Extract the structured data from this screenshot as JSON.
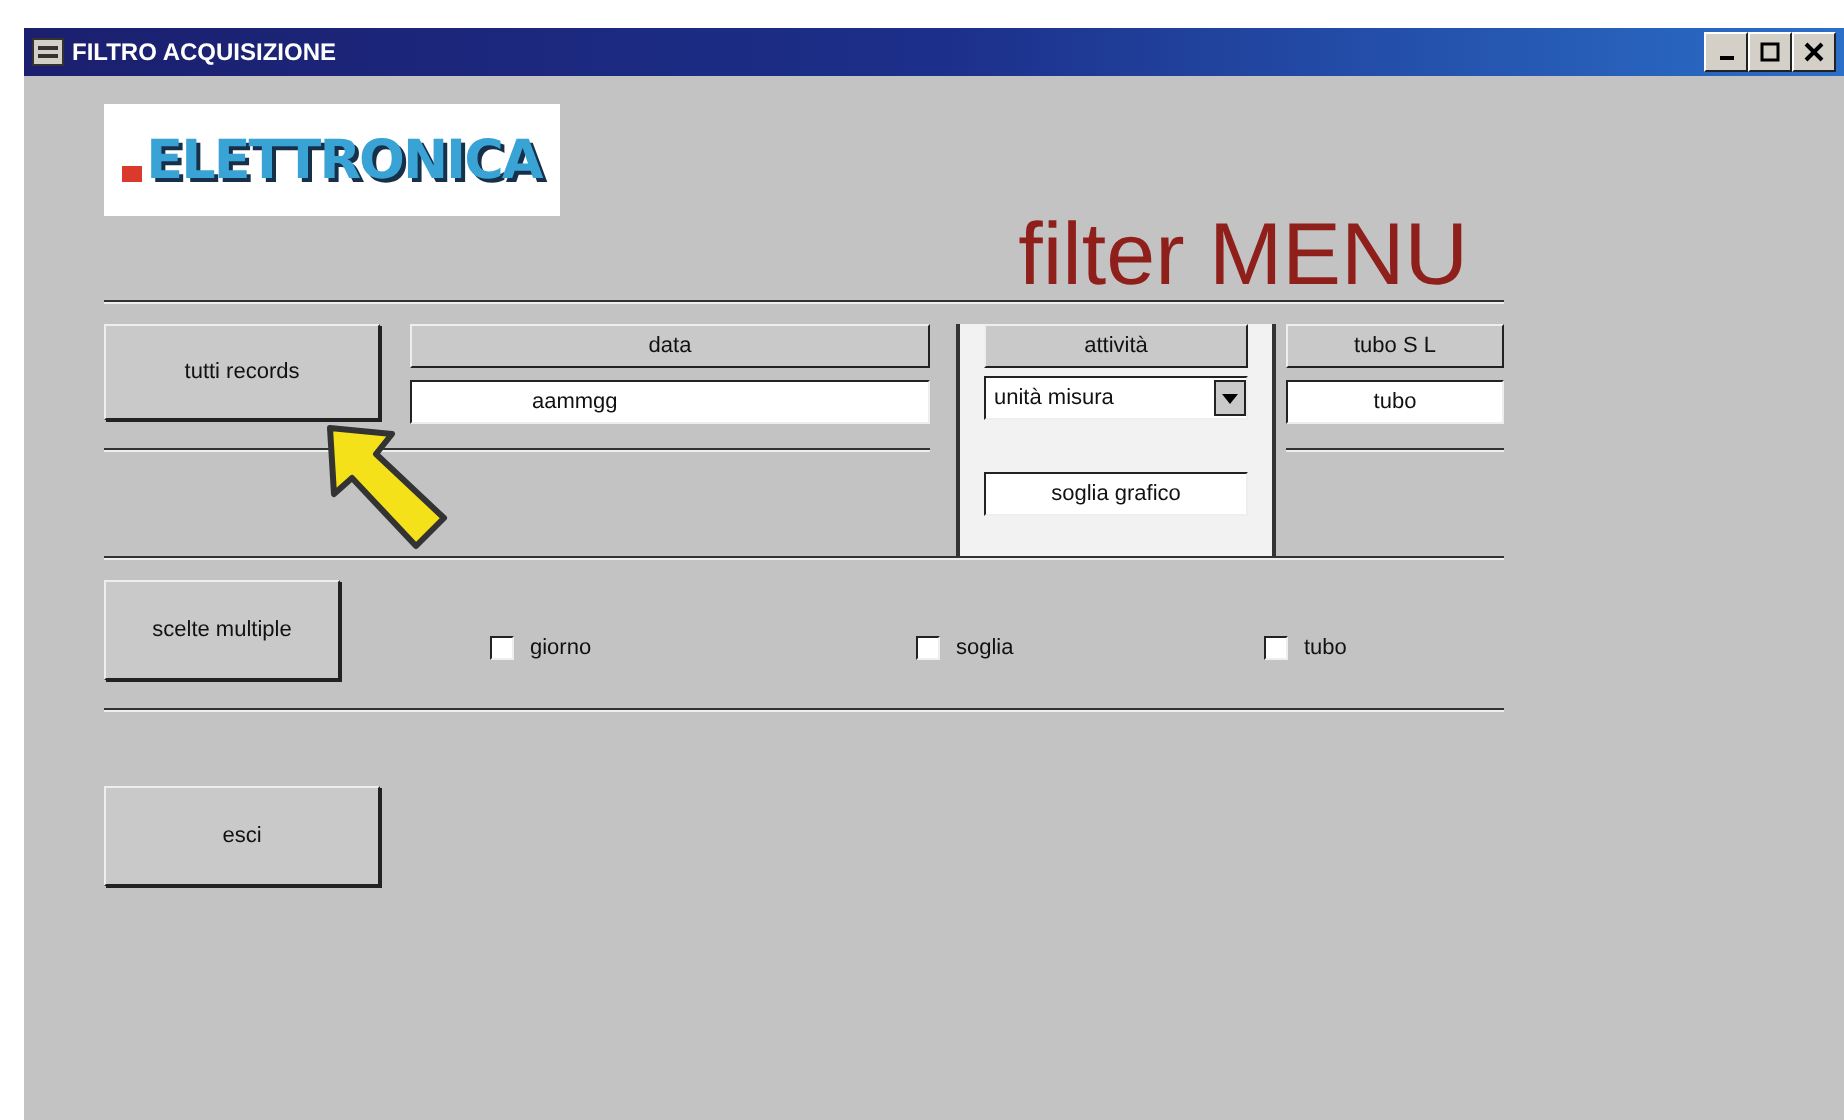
{
  "window": {
    "title": "FILTRO ACQUISIZIONE"
  },
  "logo": {
    "text": "ELETTRONICA"
  },
  "heading": "filter MENU",
  "filters": {
    "all_button": "tutti records",
    "columns": [
      {
        "header": "data",
        "kind": "text",
        "value": "aammgg"
      },
      {
        "header": "attività",
        "kind": "select",
        "value": "unità misura"
      },
      {
        "header": "tubo S L",
        "kind": "text",
        "value": "tubo"
      }
    ],
    "threshold_field": "soglia grafico"
  },
  "multiple": {
    "button": "scelte multiple",
    "options": [
      {
        "label": "giorno",
        "checked": false
      },
      {
        "label": "soglia",
        "checked": false
      },
      {
        "label": "tubo",
        "checked": false
      }
    ]
  },
  "exit_button": "esci"
}
